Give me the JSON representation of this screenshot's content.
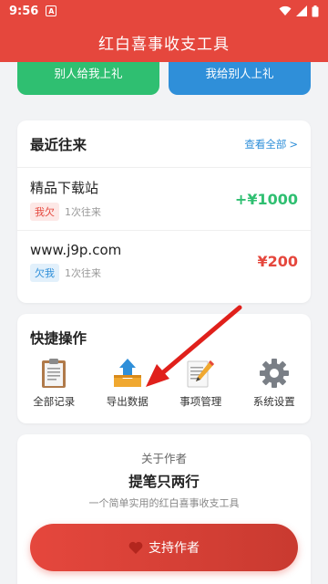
{
  "status_bar": {
    "time": "9:56",
    "a_icon": "A"
  },
  "app_bar": {
    "title": "红白喜事收支工具"
  },
  "quick_buttons": {
    "received": "别人给我上礼",
    "given": "我给别人上礼"
  },
  "recent": {
    "title": "最近往来",
    "view_all": "查看全部",
    "view_all_chevron": ">",
    "items": [
      {
        "name": "精品下载站",
        "tag": "我欠",
        "count": "1次往来",
        "amount": "+¥1000"
      },
      {
        "name": "www.j9p.com",
        "tag": "欠我",
        "count": "1次往来",
        "amount": "¥200"
      }
    ]
  },
  "quick_actions": {
    "title": "快捷操作",
    "items": [
      {
        "label": "全部记录",
        "icon": "clipboard-icon"
      },
      {
        "label": "导出数据",
        "icon": "export-tray-icon"
      },
      {
        "label": "事项管理",
        "icon": "memo-pencil-icon"
      },
      {
        "label": "系统设置",
        "icon": "gear-icon"
      }
    ]
  },
  "author": {
    "about": "关于作者",
    "name": "提笔只两行",
    "desc": "一个简单实用的红白喜事收支工具",
    "support": "支持作者"
  },
  "colors": {
    "primary_red": "#e5473d",
    "green": "#2fbf71",
    "blue": "#2f8fd9",
    "annotation_arrow": "#e0201b"
  }
}
